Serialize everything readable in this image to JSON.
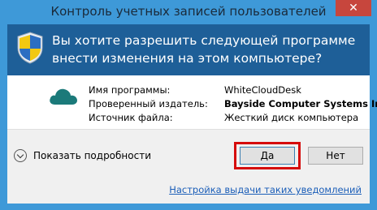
{
  "window": {
    "title": "Контроль учетных записей пользователей",
    "close_label": "✕"
  },
  "header": {
    "question": "Вы хотите разрешить следующей программе внести изменения на этом компьютере?"
  },
  "program": {
    "rows": [
      {
        "label": "Имя программы:",
        "value": "WhiteCloudDesk"
      },
      {
        "label": "Проверенный издатель:",
        "value": "Bayside Computer Systems Inc"
      },
      {
        "label": "Источник файла:",
        "value": "Жесткий диск компьютера"
      }
    ]
  },
  "footer": {
    "show_details": "Показать подробности",
    "yes": "Да",
    "no": "Нет",
    "notification_link": "Настройка выдачи таких уведомлений"
  },
  "colors": {
    "frame": "#3e99d8",
    "header": "#1e5f98",
    "highlight": "#d50b0b",
    "link": "#1b5eb8"
  },
  "icons": {
    "shield": "uac-shield-icon",
    "program": "cloud-icon",
    "details": "chevron-down-icon"
  }
}
